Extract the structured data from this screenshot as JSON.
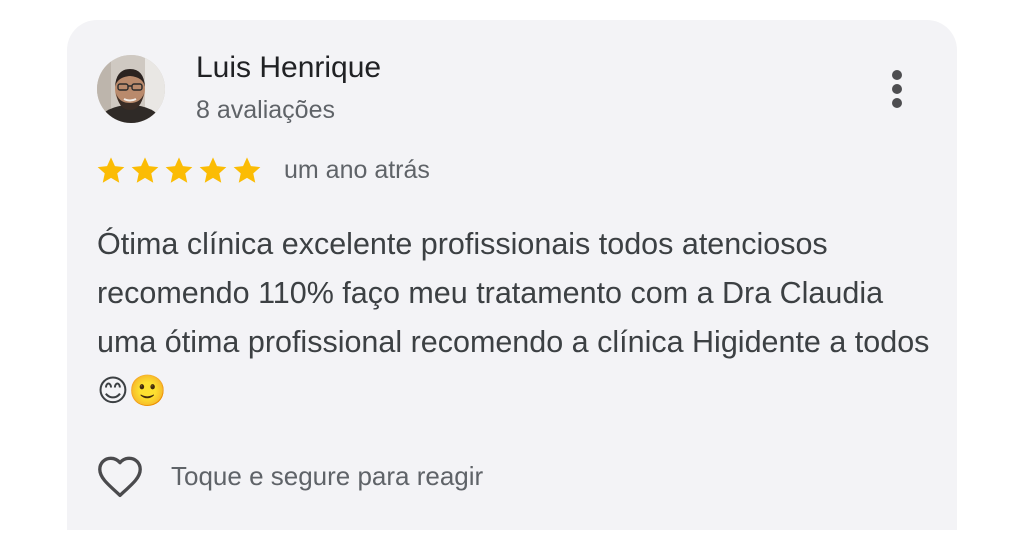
{
  "review": {
    "author": "Luis Henrique",
    "reviews_count": "8 avaliações",
    "rating": 5,
    "rating_max": 5,
    "date": "um ano atrás",
    "text": "Ótima clínica excelente profissionais todos atenciosos recomendo 110% faço meu tratamento com a Dra Claudia uma ótima profissional recomendo a clínica Higidente a todos 😊🙂",
    "react_label": "Toque e segure para reagir"
  },
  "icons": {
    "avatar": "profile-photo",
    "more": "more-vert-icon",
    "star": "star-icon",
    "react": "heart-outline-icon"
  },
  "colors": {
    "star": "#fbbc04",
    "card_background": "#f3f3f6",
    "name": "#202124",
    "secondary_text": "#5f6368",
    "body_text": "#3c4043"
  }
}
